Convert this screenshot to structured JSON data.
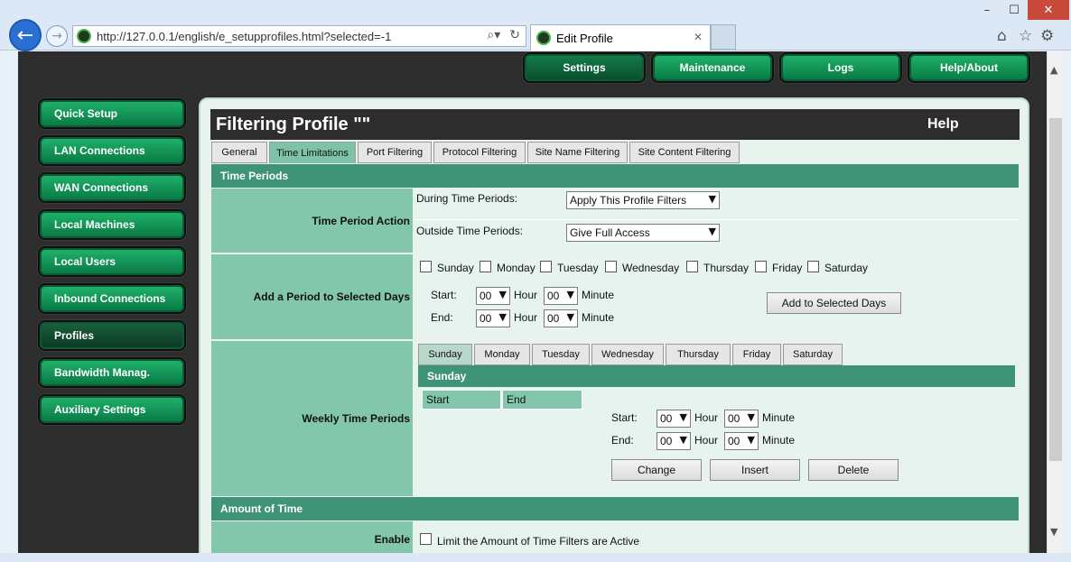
{
  "browser": {
    "url": "http://127.0.0.1/english/e_setupprofiles.html?selected=-1",
    "tab_title": "Edit Profile",
    "minimize": "–",
    "maximize": "☐",
    "close": "✕"
  },
  "topnav": [
    "Settings",
    "Maintenance",
    "Logs",
    "Help/About"
  ],
  "sidebar": [
    "Quick Setup",
    "LAN Connections",
    "WAN Connections",
    "Local Machines",
    "Local Users",
    "Inbound Connections",
    "Profiles",
    "Bandwidth Manag.",
    "Auxiliary Settings"
  ],
  "panel": {
    "title": "Filtering Profile \"\"",
    "help": "Help",
    "tabs": [
      "General",
      "Time Limitations",
      "Port Filtering",
      "Protocol Filtering",
      "Site Name Filtering",
      "Site Content Filtering"
    ]
  },
  "time_periods": {
    "section": "Time Periods",
    "action_label": "Time Period Action",
    "during_label": "During Time Periods:",
    "during_value": "Apply This Profile Filters",
    "outside_label": "Outside Time Periods:",
    "outside_value": "Give Full Access",
    "add_label": "Add a Period to Selected Days",
    "days": [
      "Sunday",
      "Monday",
      "Tuesday",
      "Wednesday",
      "Thursday",
      "Friday",
      "Saturday"
    ],
    "start_label": "Start:",
    "end_label": "End:",
    "hour_label": "Hour",
    "minute_label": "Minute",
    "time_zero": "00",
    "add_button": "Add to Selected Days",
    "weekly_label": "Weekly Time Periods",
    "selected_day": "Sunday",
    "col_start": "Start",
    "col_end": "End",
    "change_button": "Change",
    "insert_button": "Insert",
    "delete_button": "Delete"
  },
  "amount": {
    "section": "Amount of Time",
    "enable_label": "Enable",
    "limit_text": "Limit the Amount of Time Filters are Active"
  }
}
